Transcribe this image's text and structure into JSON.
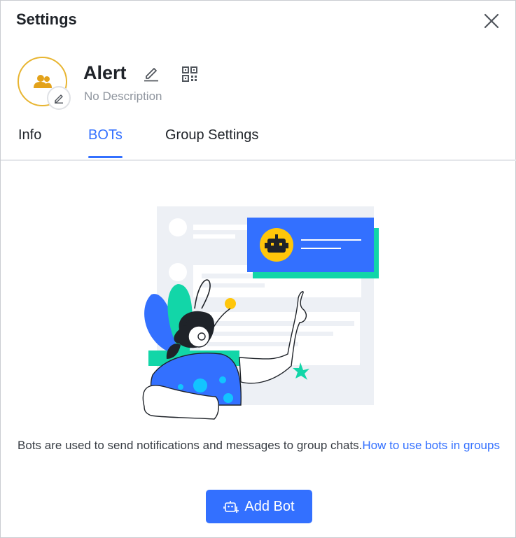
{
  "dialog": {
    "title": "Settings",
    "close_icon": "close-icon"
  },
  "group": {
    "name": "Alert",
    "description": "No Description",
    "avatar_icon": "group-users-icon",
    "avatar_color": "#e8b531"
  },
  "tabs": [
    {
      "label": "Info",
      "active": false
    },
    {
      "label": "BOTs",
      "active": true
    },
    {
      "label": "Group Settings",
      "active": false
    }
  ],
  "empty_state": {
    "text": "Bots are used to send notifications and messages to group chats.",
    "link": "How to use bots in groups"
  },
  "actions": {
    "add_bot_label": "Add Bot",
    "add_bot_icon": "add-bot-icon"
  },
  "colors": {
    "accent": "#3370ff",
    "teal": "#12d6a8",
    "yellow": "#ffc60a"
  }
}
